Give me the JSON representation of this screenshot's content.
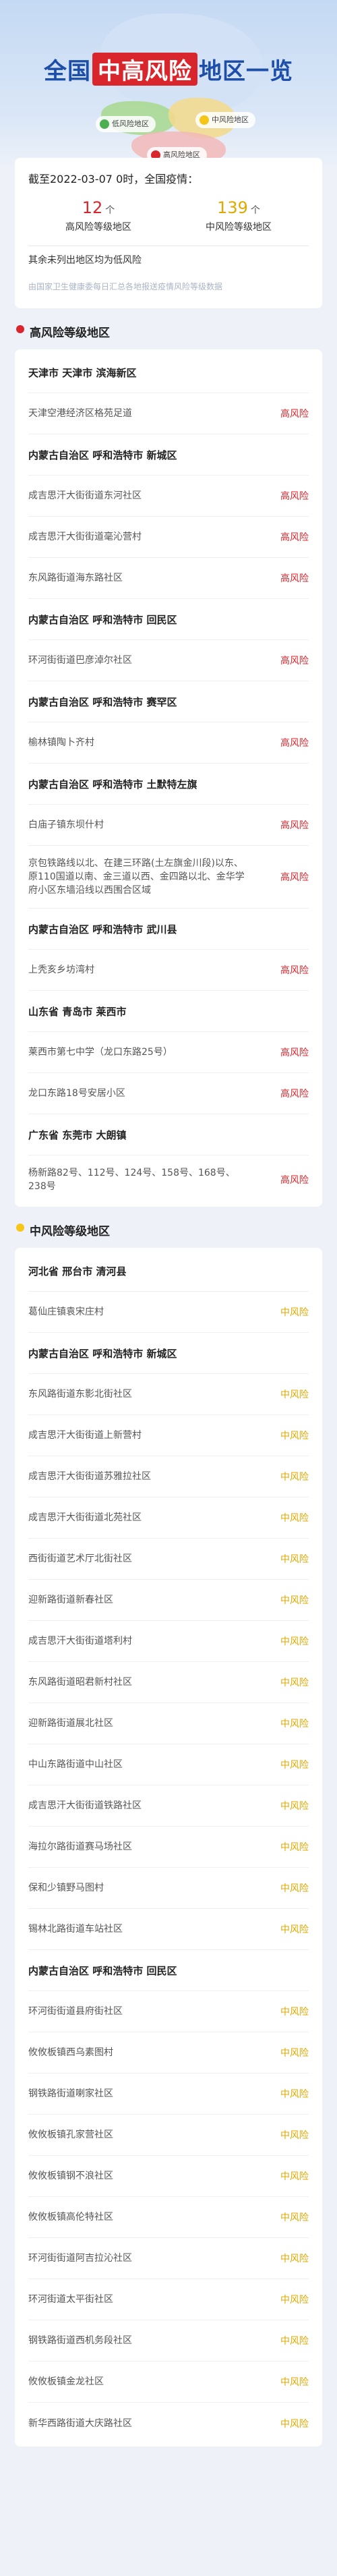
{
  "header": {
    "title_part1": "全国",
    "title_highlight": "中高风险",
    "title_part2": "地区一览",
    "legend": {
      "low": "低风险地区",
      "mid": "中风险地区",
      "high": "高风险地区"
    },
    "colors": {
      "low": "#4caf50",
      "mid": "#f5c518",
      "high": "#d9262c"
    }
  },
  "summary": {
    "date_text": "截至2022-03-07 0时，全国疫情：",
    "high_count": "12",
    "high_unit": "个",
    "high_label": "高风险等级地区",
    "mid_count": "139",
    "mid_unit": "个",
    "mid_label": "中风险等级地区",
    "rest_text": "其余未列出地区均为低风险",
    "source": "由国家卫生健康委每日汇总各地报送疫情风险等级数据"
  },
  "high_section": {
    "title": "高风险等级地区",
    "rows": [
      {
        "type": "group",
        "name": "天津市 天津市 滨海新区"
      },
      {
        "type": "item",
        "name": "天津空港经济区格苑足道",
        "level": "高风险"
      },
      {
        "type": "group",
        "name": "内蒙古自治区 呼和浩特市 新城区"
      },
      {
        "type": "item",
        "name": "成吉思汗大街街道东河社区",
        "level": "高风险"
      },
      {
        "type": "item",
        "name": "成吉思汗大街街道毫沁营村",
        "level": "高风险"
      },
      {
        "type": "item",
        "name": "东风路街道海东路社区",
        "level": "高风险"
      },
      {
        "type": "group",
        "name": "内蒙古自治区 呼和浩特市 回民区"
      },
      {
        "type": "item",
        "name": "环河街街道巴彦淖尔社区",
        "level": "高风险"
      },
      {
        "type": "group",
        "name": "内蒙古自治区 呼和浩特市 赛罕区"
      },
      {
        "type": "item",
        "name": "榆林镇陶卜齐村",
        "level": "高风险"
      },
      {
        "type": "group",
        "name": "内蒙古自治区 呼和浩特市 土默特左旗"
      },
      {
        "type": "item",
        "name": "白庙子镇东坝什村",
        "level": "高风险"
      },
      {
        "type": "item",
        "name": "京包铁路线以北、在建三环路(土左旗金川段)以东、原110国道以南、金三道以西、金四路以北、金华学府小区东墙沿线以西围合区域",
        "level": "高风险",
        "tall": true
      },
      {
        "type": "group",
        "name": "内蒙古自治区 呼和浩特市 武川县"
      },
      {
        "type": "item",
        "name": "上秃亥乡坊湾村",
        "level": "高风险"
      },
      {
        "type": "group",
        "name": "山东省 青岛市 莱西市"
      },
      {
        "type": "item",
        "name": "莱西市第七中学（龙口东路25号）",
        "level": "高风险"
      },
      {
        "type": "item",
        "name": "龙口东路18号安居小区",
        "level": "高风险"
      },
      {
        "type": "group",
        "name": "广东省 东莞市 大朗镇"
      },
      {
        "type": "item",
        "name": "杨新路82号、112号、124号、158号、168号、238号",
        "level": "高风险",
        "tall": true
      }
    ]
  },
  "mid_section": {
    "title": "中风险等级地区",
    "rows": [
      {
        "type": "group",
        "name": "河北省 邢台市 清河县"
      },
      {
        "type": "item",
        "name": "葛仙庄镇袁宋庄村",
        "level": "中风险"
      },
      {
        "type": "group",
        "name": "内蒙古自治区 呼和浩特市 新城区"
      },
      {
        "type": "item",
        "name": "东风路街道东影北街社区",
        "level": "中风险"
      },
      {
        "type": "item",
        "name": "成吉思汗大街街道上新营村",
        "level": "中风险"
      },
      {
        "type": "item",
        "name": "成吉思汗大街街道苏雅拉社区",
        "level": "中风险"
      },
      {
        "type": "item",
        "name": "成吉思汗大街街道北苑社区",
        "level": "中风险"
      },
      {
        "type": "item",
        "name": "西街街道艺术厅北街社区",
        "level": "中风险"
      },
      {
        "type": "item",
        "name": "迎新路街道新春社区",
        "level": "中风险"
      },
      {
        "type": "item",
        "name": "成吉思汗大街街道塔利村",
        "level": "中风险"
      },
      {
        "type": "item",
        "name": "东风路街道昭君新村社区",
        "level": "中风险"
      },
      {
        "type": "item",
        "name": "迎新路街道展北社区",
        "level": "中风险"
      },
      {
        "type": "item",
        "name": "中山东路街道中山社区",
        "level": "中风险"
      },
      {
        "type": "item",
        "name": "成吉思汗大街街道铁路社区",
        "level": "中风险"
      },
      {
        "type": "item",
        "name": "海拉尔路街道赛马场社区",
        "level": "中风险"
      },
      {
        "type": "item",
        "name": "保和少镇野马图村",
        "level": "中风险"
      },
      {
        "type": "item",
        "name": "锡林北路街道车站社区",
        "level": "中风险"
      },
      {
        "type": "group",
        "name": "内蒙古自治区 呼和浩特市 回民区"
      },
      {
        "type": "item",
        "name": "环河街街道县府街社区",
        "level": "中风险"
      },
      {
        "type": "item",
        "name": "攸攸板镇西乌素图村",
        "level": "中风险"
      },
      {
        "type": "item",
        "name": "钢铁路街道喇家社区",
        "level": "中风险"
      },
      {
        "type": "item",
        "name": "攸攸板镇孔家营社区",
        "level": "中风险"
      },
      {
        "type": "item",
        "name": "攸攸板镇钢不浪社区",
        "level": "中风险"
      },
      {
        "type": "item",
        "name": "攸攸板镇高伦特社区",
        "level": "中风险"
      },
      {
        "type": "item",
        "name": "环河街街道阿吉拉沁社区",
        "level": "中风险"
      },
      {
        "type": "item",
        "name": "环河街道太平街社区",
        "level": "中风险"
      },
      {
        "type": "item",
        "name": "钢铁路街道西机务段社区",
        "level": "中风险"
      },
      {
        "type": "item",
        "name": "攸攸板镇金龙社区",
        "level": "中风险"
      },
      {
        "type": "item",
        "name": "新华西路街道大庆路社区",
        "level": "中风险"
      }
    ]
  }
}
